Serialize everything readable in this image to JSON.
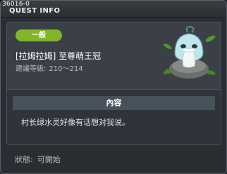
{
  "window": {
    "quest_id": "36016-0",
    "title": "QUEST INFO"
  },
  "quest": {
    "category": "一般",
    "name": "[拉姆拉姆] 至尊萌王冠",
    "level_label": "建議等級:",
    "level_range": "210～214",
    "npc_icon": "green-slime-elder-npc"
  },
  "content": {
    "header": "內容",
    "text": "村长绿水灵好像有话想对我说。"
  },
  "status": {
    "label": "狀態:",
    "value": "可開始"
  },
  "colors": {
    "badge": "#82b52b",
    "panel": "#3b4046",
    "header_bar": "#47515a"
  }
}
